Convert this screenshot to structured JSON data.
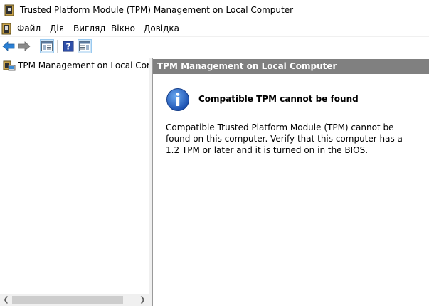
{
  "window": {
    "title": "Trusted Platform Module (TPM) Management on Local Computer"
  },
  "menu": {
    "items": [
      {
        "label": "Файл"
      },
      {
        "label": "Дія"
      },
      {
        "label": "Вигляд"
      },
      {
        "label": "Вікно"
      },
      {
        "label": "Довідка"
      }
    ]
  },
  "toolbar": {
    "buttons": [
      {
        "icon": "back-arrow-icon"
      },
      {
        "icon": "forward-arrow-icon"
      },
      {
        "icon": "show-hide-console-tree-icon"
      },
      {
        "icon": "help-icon"
      },
      {
        "icon": "show-hide-action-pane-icon"
      }
    ]
  },
  "tree": {
    "items": [
      {
        "label": "TPM Management on Local Comp"
      }
    ]
  },
  "detail": {
    "header": "TPM Management on Local Computer",
    "message_title": "Compatible TPM cannot be found",
    "message_body": "Compatible Trusted Platform Module (TPM) cannot be found on this computer. Verify that this computer has a 1.2 TPM or later and it is turned on in the BIOS."
  },
  "colors": {
    "header_bg": "#808080",
    "accent_blue": "#1f5fbf",
    "toolbar_active": "#cce4f7"
  }
}
